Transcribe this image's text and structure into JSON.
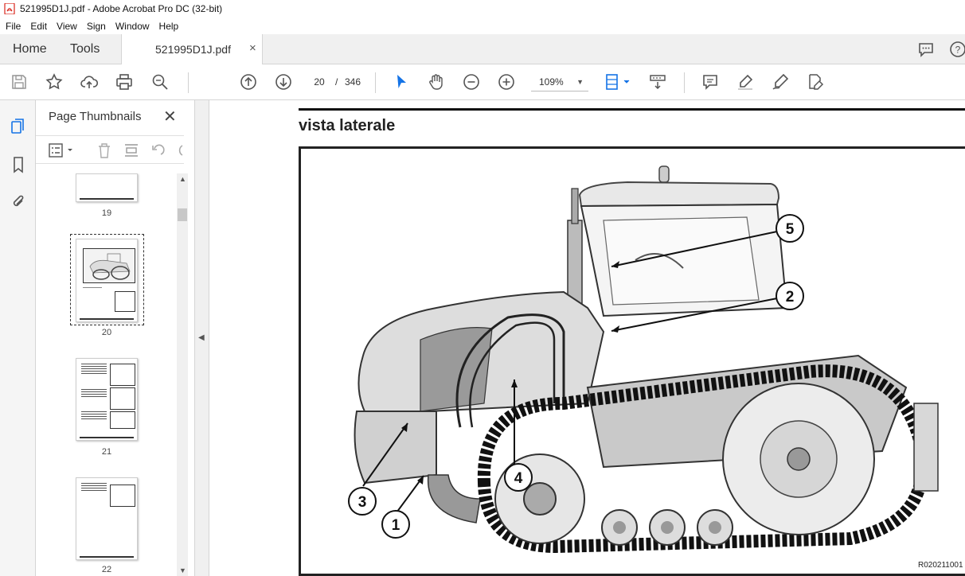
{
  "window": {
    "title": "521995D1J.pdf - Adobe Acrobat Pro DC (32-bit)"
  },
  "menu": {
    "items": [
      "File",
      "Edit",
      "View",
      "Sign",
      "Window",
      "Help"
    ]
  },
  "tabs": {
    "home": "Home",
    "tools": "Tools",
    "document": "521995D1J.pdf",
    "close": "×"
  },
  "toolbar": {
    "page_current": "20",
    "page_separator": "/",
    "page_total": "346",
    "zoom": "109%"
  },
  "thumbnails": {
    "title": "Page Thumbnails",
    "close": "✕",
    "pages": [
      "19",
      "20",
      "21",
      "22"
    ]
  },
  "document": {
    "heading": "vista laterale",
    "figure_ref": "R020211001",
    "callouts": [
      "1",
      "2",
      "3",
      "4",
      "5"
    ]
  },
  "colors": {
    "accent": "#1473e6",
    "pdf_red": "#d9261c"
  }
}
